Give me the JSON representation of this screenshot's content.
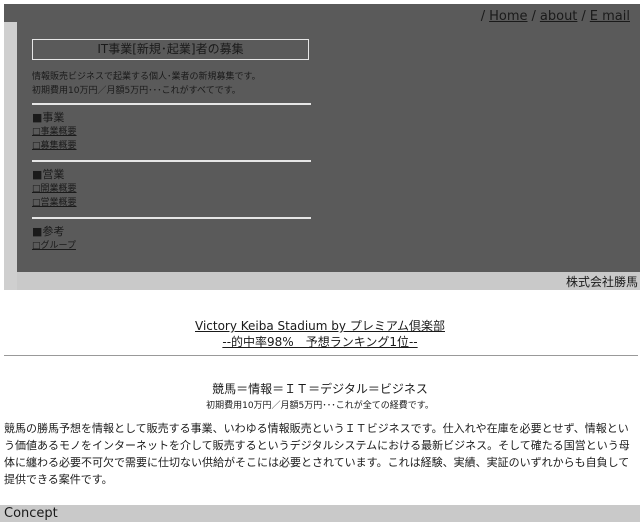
{
  "nav": {
    "items": [
      "Home",
      "about",
      "E mail"
    ],
    "separator": "/"
  },
  "panel": {
    "title": "IT事業[新規･起業]者の募集",
    "desc_line1": "情報販売ビジネスで起業する個人･業者の新規募集です。",
    "desc_line2": "初期費用10万円／月額5万円･･･これがすべてです。",
    "sections": [
      {
        "heading": "■事業",
        "items": [
          "□事業概要",
          "□募集概要"
        ]
      },
      {
        "heading": "■営業",
        "items": [
          "□開業概要",
          "□営業概要"
        ]
      },
      {
        "heading": "■参考",
        "items": [
          "□グループ"
        ]
      }
    ]
  },
  "corp": {
    "name": "株式会社勝馬"
  },
  "hero": {
    "link1": "Victory Keiba Stadium by プレミアム倶楽部",
    "link2": "--的中率98%　予想ランキング1位--"
  },
  "intro": {
    "title": "競馬＝情報＝ＩＴ＝デジタル＝ビジネス",
    "note": "初期費用10万円／月額5万円･･･これが全ての経費です。",
    "body": "競馬の勝馬予想を情報として販売する事業、いわゆる情報販売というＩＴビジネスです。仕入れや在庫を必要とせず、情報という価値あるモノをインターネットを介して販売するというデジタルシステムにおける最新ビジネス。そして確たる国営という母体に纏わる必要不可欠で需要に仕切ない供給がそこには必要とされています。これは経験、実績、実証のいずれからも自負して提供できる案件です。"
  },
  "concept": {
    "label": "Concept"
  }
}
